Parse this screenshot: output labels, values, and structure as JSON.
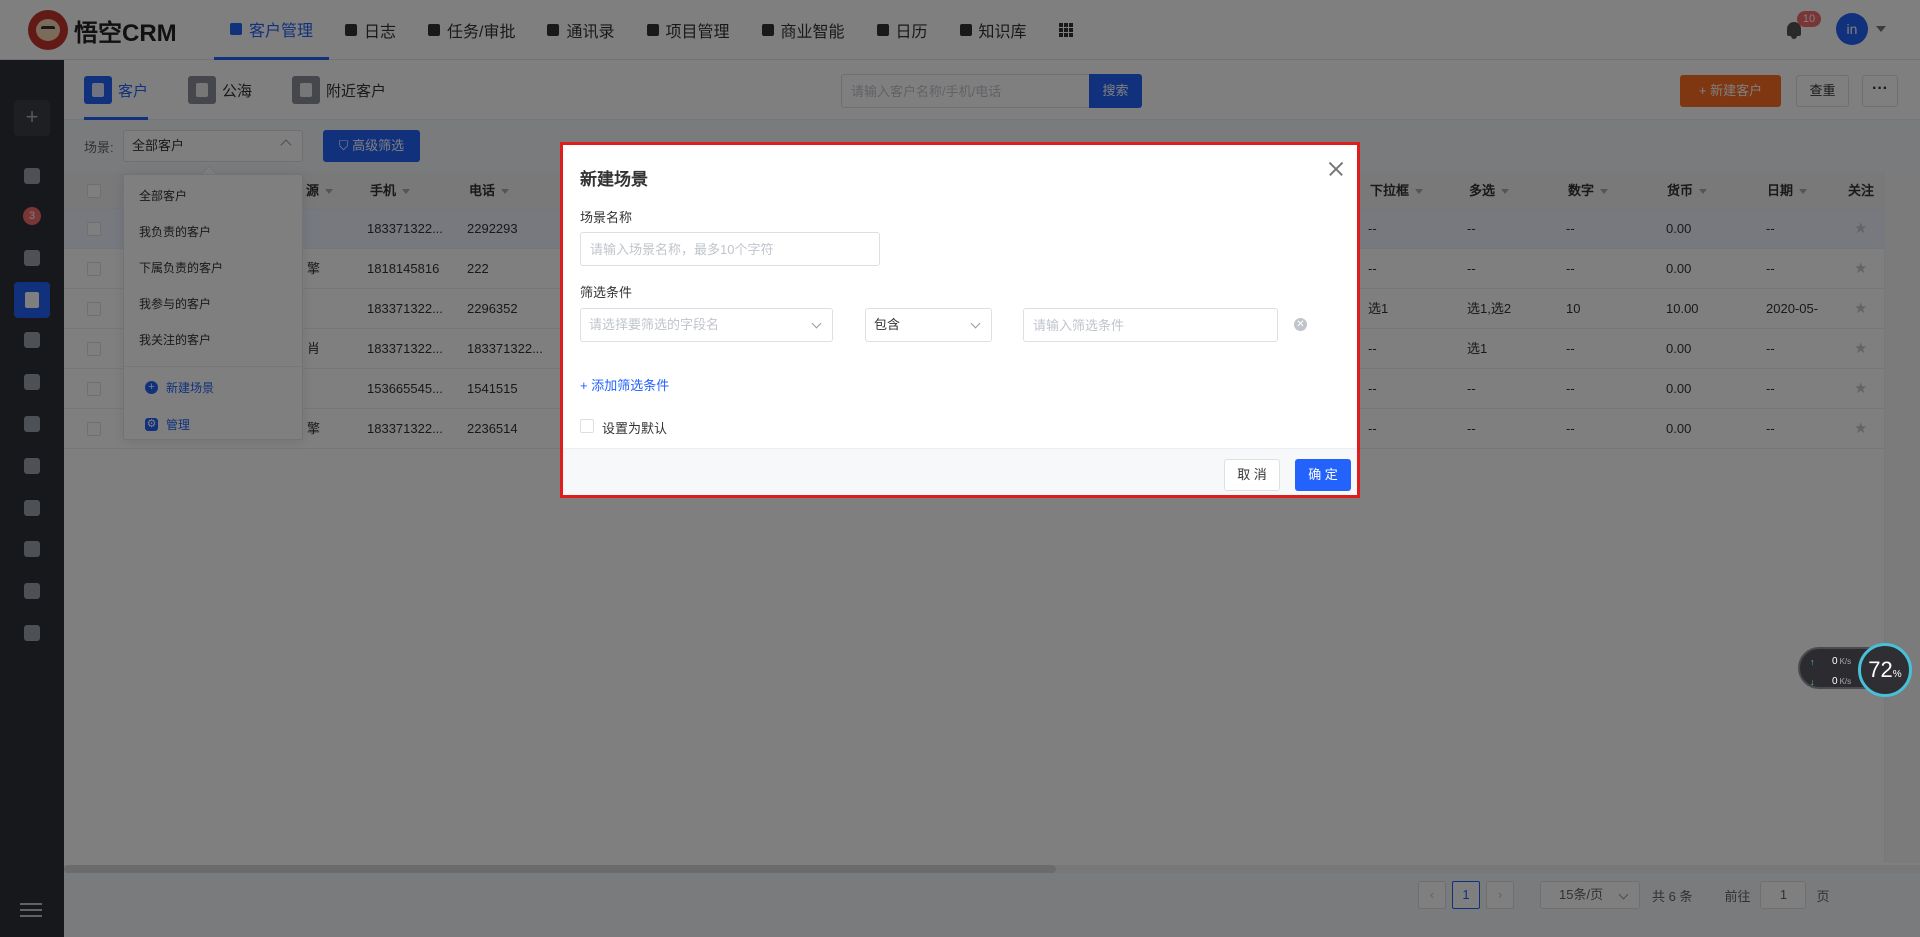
{
  "app": {
    "title": "悟空CRM"
  },
  "nav": [
    {
      "label": "客户管理",
      "icon": "building-icon",
      "active": true
    },
    {
      "label": "日志",
      "icon": "log-icon"
    },
    {
      "label": "任务/审批",
      "icon": "briefcase-icon"
    },
    {
      "label": "通讯录",
      "icon": "phone-book-icon"
    },
    {
      "label": "项目管理",
      "icon": "project-icon"
    },
    {
      "label": "商业智能",
      "icon": "bi-icon"
    },
    {
      "label": "日历",
      "icon": "calendar-icon"
    },
    {
      "label": "知识库",
      "icon": "book-icon"
    }
  ],
  "header": {
    "notifications": "10",
    "avatar": "in"
  },
  "sidebar": {
    "badge": "3",
    "add_label": "+"
  },
  "subtabs": [
    {
      "label": "客户",
      "icon": "customer-icon",
      "active": true
    },
    {
      "label": "公海",
      "icon": "sea-icon"
    },
    {
      "label": "附近客户",
      "icon": "nearby-icon"
    }
  ],
  "search": {
    "placeholder": "请输入客户名称/手机/电话",
    "button": "搜索"
  },
  "actions": {
    "new_customer": "+  新建客户",
    "dedupe": "查重",
    "more": "···"
  },
  "filter": {
    "scene_label": "场景:",
    "scene_value": "全部客户",
    "advanced": "高级筛选"
  },
  "scene_menu": {
    "items": [
      "全部客户",
      "我负责的客户",
      "下属负责的客户",
      "我参与的客户",
      "我关注的客户"
    ],
    "new_scene": "新建场景",
    "manage": "管理"
  },
  "table": {
    "columns_left": [
      {
        "label": "源",
        "sortable": true
      },
      {
        "label": "手机",
        "sortable": true
      },
      {
        "label": "电话",
        "sortable": true
      }
    ],
    "columns_right": [
      {
        "label": "下拉框",
        "sortable": true
      },
      {
        "label": "多选",
        "sortable": true
      },
      {
        "label": "数字",
        "sortable": true
      },
      {
        "label": "货币",
        "sortable": true
      },
      {
        "label": "日期",
        "sortable": true
      },
      {
        "label": "关注",
        "sortable": false
      }
    ],
    "rows": [
      {
        "source": "",
        "mobile": "183371322...",
        "phone": "2292293",
        "dropdown": "--",
        "multi": "--",
        "number": "--",
        "currency": "0.00",
        "date": "--"
      },
      {
        "source": "擎",
        "mobile": "1818145816",
        "phone": "222",
        "dropdown": "--",
        "multi": "--",
        "number": "--",
        "currency": "0.00",
        "date": "--"
      },
      {
        "source": "",
        "mobile": "183371322...",
        "phone": "2296352",
        "dropdown": "选1",
        "multi": "选1,选2",
        "number": "10",
        "currency": "10.00",
        "date": "2020-05-"
      },
      {
        "source": "肖",
        "mobile": "183371322...",
        "phone": "183371322...",
        "dropdown": "--",
        "multi": "选1",
        "number": "--",
        "currency": "0.00",
        "date": "--"
      },
      {
        "source": "",
        "mobile": "153665545...",
        "phone": "1541515",
        "dropdown": "--",
        "multi": "--",
        "number": "--",
        "currency": "0.00",
        "date": "--"
      },
      {
        "source": "擎",
        "mobile": "183371322...",
        "phone": "2236514",
        "dropdown": "--",
        "multi": "--",
        "number": "--",
        "currency": "0.00",
        "date": "--"
      }
    ]
  },
  "pagination": {
    "current": "1",
    "page_size": "15条/页",
    "total": "共 6 条",
    "goto_label": "前往",
    "goto_value": "1",
    "page_suffix": "页"
  },
  "modal": {
    "title": "新建场景",
    "name_label": "场景名称",
    "name_placeholder": "请输入场景名称，最多10个字符",
    "cond_label": "筛选条件",
    "field_placeholder": "请选择要筛选的字段名",
    "operator": "包含",
    "value_placeholder": "请输入筛选条件",
    "add_condition": "+ 添加筛选条件",
    "set_default": "设置为默认",
    "cancel": "取 消",
    "ok": "确 定"
  },
  "net_widget": {
    "up": "0",
    "down": "0",
    "unit": "K/s",
    "percent": "72",
    "percent_sign": "%"
  },
  "colors": {
    "primary": "#2362fb",
    "orange": "#fc6e23",
    "highlight": "#e01d1d"
  }
}
